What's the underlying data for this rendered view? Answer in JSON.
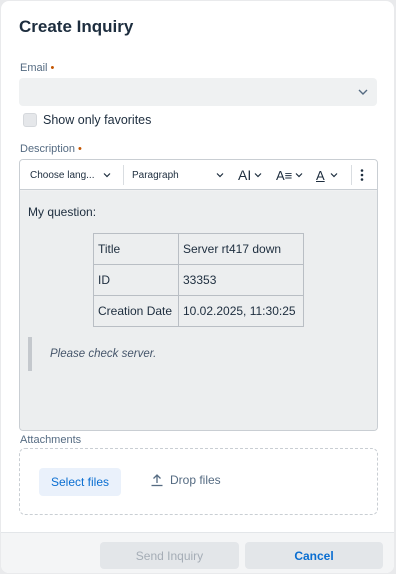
{
  "dialog": {
    "title": "Create Inquiry"
  },
  "email": {
    "label": "Email",
    "required_mark": "•",
    "value": ""
  },
  "favorites": {
    "label": "Show only favorites",
    "checked": false
  },
  "description": {
    "label": "Description",
    "required_mark": "•",
    "toolbar": {
      "language": "Choose lang...",
      "format": "Paragraph",
      "font_size_icon": "AI",
      "text_style_icon": "A≡",
      "font_color_icon": "A"
    },
    "content": {
      "intro": "My question:",
      "table": [
        {
          "key": "Title",
          "value": "Server rt417 down"
        },
        {
          "key": "ID",
          "value": "33353"
        },
        {
          "key": "Creation Date",
          "value": "10.02.2025, 11:30:25"
        }
      ],
      "quote": "Please check server."
    }
  },
  "attachments": {
    "label": "Attachments",
    "select_button": "Select files",
    "drop_text": "Drop files"
  },
  "footer": {
    "send_button": "Send Inquiry",
    "cancel_button": "Cancel"
  },
  "colors": {
    "accent": "#0a6ed1",
    "required": "#c35500",
    "text": "#1d2d3e"
  }
}
